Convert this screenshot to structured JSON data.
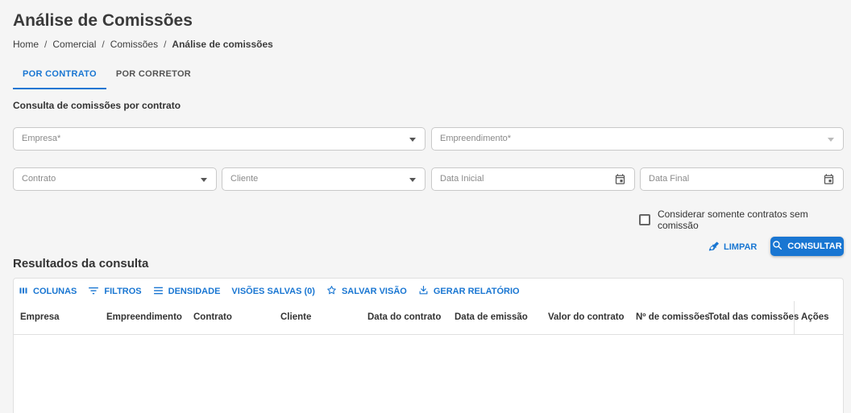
{
  "page": {
    "title": "Análise de Comissões",
    "breadcrumb": [
      "Home",
      "Comercial",
      "Comissões",
      "Análise de comissões"
    ]
  },
  "tabs": [
    {
      "label": "POR CONTRATO",
      "active": true
    },
    {
      "label": "POR CORRETOR",
      "active": false
    }
  ],
  "form": {
    "section_title": "Consulta de comissões por contrato",
    "empresa_placeholder": "Empresa*",
    "empreendimento_placeholder": "Empreendimento*",
    "contrato_placeholder": "Contrato",
    "cliente_placeholder": "Cliente",
    "data_inicial_placeholder": "Data Inicial",
    "data_final_placeholder": "Data Final",
    "checkbox_label": "Considerar somente contratos sem comissão",
    "checkbox_checked": false,
    "limpar_label": "LIMPAR",
    "consultar_label": "CONSULTAR"
  },
  "results": {
    "title": "Resultados da consulta",
    "toolbar": {
      "colunas": "COLUNAS",
      "filtros": "FILTROS",
      "densidade": "DENSIDADE",
      "visoes_salvas": "VISÕES SALVAS (0)",
      "salvar_visao": "SALVAR VISÃO",
      "gerar_relatorio": "GERAR RELATÓRIO"
    },
    "columns": [
      "Empresa",
      "Empreendimento",
      "Contrato",
      "Cliente",
      "Data do contrato",
      "Data de emissão",
      "Valor do contrato",
      "Nº de comissões",
      "Total das comissões",
      "Ações"
    ]
  },
  "colors": {
    "accent": "#1976d2",
    "background": "#f5f5f5"
  }
}
